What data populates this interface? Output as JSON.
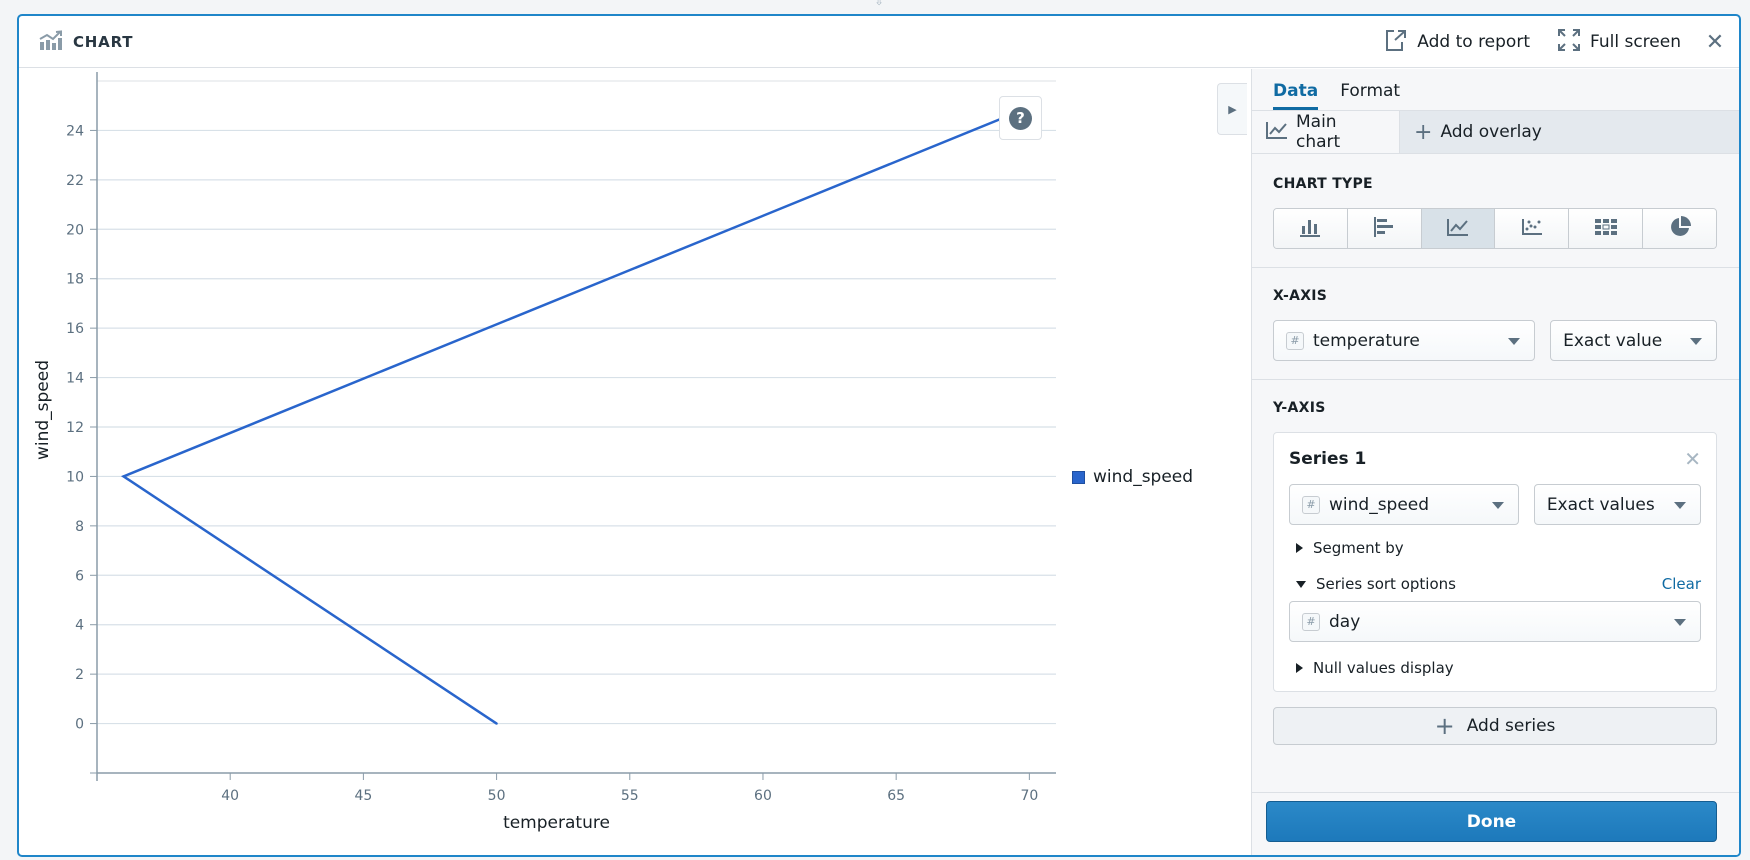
{
  "header": {
    "title": "CHART",
    "title_icon": "chart-trend-icon",
    "add_to_report_label": "Add to report",
    "full_screen_label": "Full screen",
    "close_icon": "close-icon"
  },
  "colors": {
    "accent": "#1f86c9",
    "series": "#2965cc",
    "tab_active": "#106ba3",
    "done_button": "#2383c4"
  },
  "chart_data": {
    "type": "line",
    "title": "",
    "xlabel": "temperature",
    "ylabel": "wind_speed",
    "xlim": [
      35,
      71
    ],
    "ylim": [
      -2,
      26
    ],
    "xticks": [
      40,
      45,
      50,
      55,
      60,
      65,
      70
    ],
    "yticks": [
      0,
      2,
      4,
      6,
      8,
      10,
      12,
      14,
      16,
      18,
      20,
      22,
      24
    ],
    "grid": true,
    "legend": "right",
    "series": [
      {
        "name": "wind_speed",
        "color": "#2965cc",
        "points": [
          {
            "x": 50,
            "y": 0
          },
          {
            "x": 36,
            "y": 10
          },
          {
            "x": 69,
            "y": 24.5
          }
        ]
      }
    ]
  },
  "help_button": "?",
  "panel": {
    "tabs": [
      {
        "label": "Data",
        "active": true
      },
      {
        "label": "Format",
        "active": false
      }
    ],
    "subtabs": {
      "main_chart": "Main chart",
      "add_overlay": "Add overlay"
    },
    "chart_type": {
      "title": "CHART TYPE",
      "options": [
        {
          "name": "vertical-bar-chart-icon",
          "active": false
        },
        {
          "name": "horizontal-bar-chart-icon",
          "active": false
        },
        {
          "name": "line-chart-icon",
          "active": true
        },
        {
          "name": "scatter-plot-icon",
          "active": false
        },
        {
          "name": "heatmap-grid-icon",
          "active": false
        },
        {
          "name": "pie-chart-icon",
          "active": false
        }
      ]
    },
    "x_axis": {
      "title": "X-AXIS",
      "field": "temperature",
      "aggregation": "Exact value"
    },
    "y_axis": {
      "title": "Y-AXIS",
      "series": [
        {
          "title": "Series 1",
          "field": "wind_speed",
          "aggregation": "Exact values",
          "segment_by_label": "Segment by",
          "sort_options_label": "Series sort options",
          "clear_label": "Clear",
          "sort_field": "day",
          "null_values_label": "Null values display"
        }
      ],
      "add_series_label": "Add series"
    },
    "done_label": "Done"
  }
}
